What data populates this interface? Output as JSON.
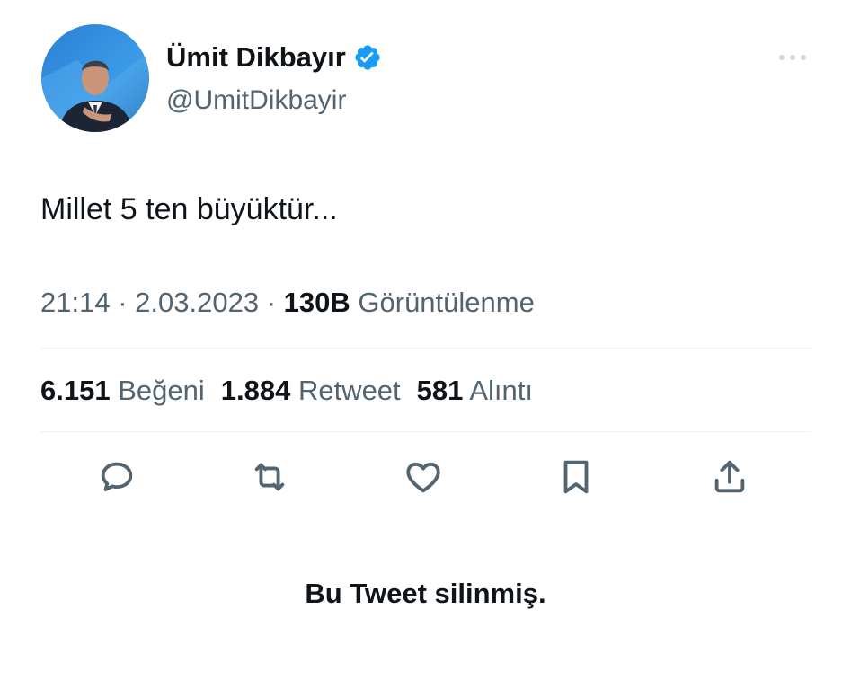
{
  "author": {
    "display_name": "Ümit Dikbayır",
    "handle": "@UmitDikbayir",
    "verified": true,
    "verified_color": "#1d9bf0"
  },
  "tweet": {
    "text": "Millet 5 ten büyüktür...",
    "time": "21:14",
    "separator": "·",
    "date": "2.03.2023",
    "views_count": "130B",
    "views_label": "Görüntülenme"
  },
  "stats": {
    "likes_count": "6.151",
    "likes_label": "Beğeni",
    "retweets_count": "1.884",
    "retweets_label": "Retweet",
    "quotes_count": "581",
    "quotes_label": "Alıntı"
  },
  "actions": [
    "reply-icon",
    "retweet-icon",
    "like-icon",
    "bookmark-icon",
    "share-icon"
  ],
  "notice": "Bu Tweet silinmiş.",
  "colors": {
    "text_primary": "#0f1419",
    "text_secondary": "#536471",
    "divider": "#eff3f4"
  }
}
